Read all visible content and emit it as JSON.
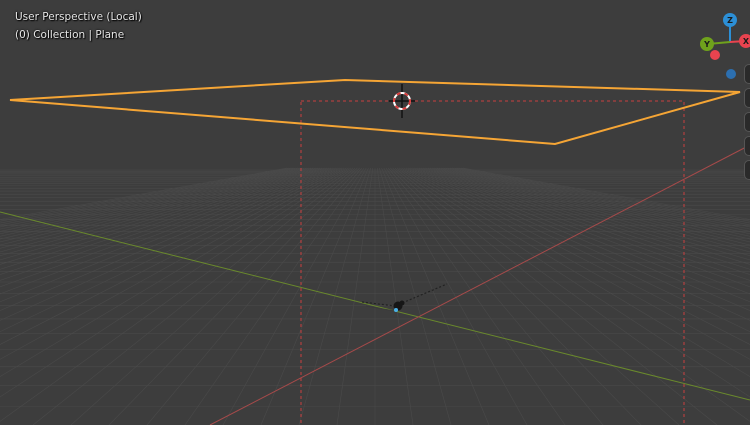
{
  "viewport": {
    "view_name": "User Perspective (Local)",
    "object_info": "(0) Collection | Plane"
  },
  "gizmo": {
    "axis_z": "Z",
    "axis_y": "Y",
    "axis_x": "X",
    "color_x": "#e8434f",
    "color_y": "#6fa21c",
    "color_z": "#2c8fd6"
  },
  "colors": {
    "background": "#3d3d3d",
    "grid": "#4a4a4a",
    "selection_outline": "#f5a535",
    "x_axis": "#a64a4a",
    "y_axis": "#6a8a2c",
    "camera_frame": "#c94040"
  }
}
